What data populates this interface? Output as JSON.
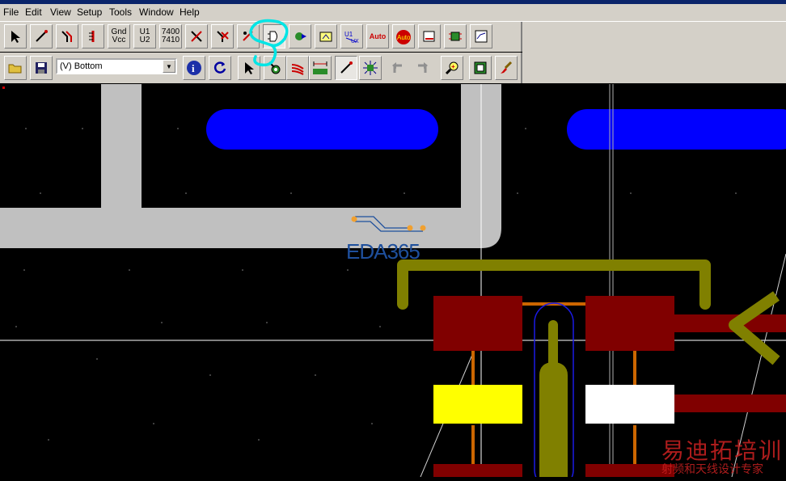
{
  "menu": {
    "file": "File",
    "edit": "Edit",
    "view": "View",
    "setup": "Setup",
    "tools": "Tools",
    "window": "Window",
    "help": "Help"
  },
  "toolbar1": {
    "gnd_top": "Gnd",
    "gnd_bottom": "Vcc",
    "u1_top": "U1",
    "u1_bottom": "U2",
    "n7400_top": "7400",
    "n7400_bottom": "7410",
    "auto1": "Auto",
    "auto2": "Auto"
  },
  "toolbar2": {
    "layer_select": "(V) Bottom"
  },
  "watermark": {
    "logo_text": "EDA365",
    "cn_title": "易迪拓培训",
    "cn_sub": "射频和天线设计专家"
  },
  "colors": {
    "trace_gray": "#c0c0c0",
    "pad_blue": "#0000ff",
    "pad_red": "#800000",
    "outline_olive": "#808000",
    "pad_yellow": "#ffff00",
    "pad_white": "#ffffff",
    "trace_orange": "#cc6600",
    "highlight_cyan": "#00e5e5"
  }
}
